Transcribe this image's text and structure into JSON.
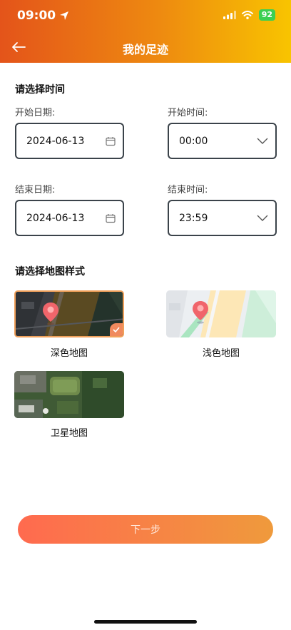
{
  "status": {
    "time": "09:00",
    "battery": "92"
  },
  "nav": {
    "title": "我的足迹"
  },
  "time_section": {
    "title": "请选择时间",
    "start_date_label": "开始日期:",
    "start_date_value": "2024-06-13",
    "start_time_label": "开始时间:",
    "start_time_value": "00:00",
    "end_date_label": "结束日期:",
    "end_date_value": "2024-06-13",
    "end_time_label": "结束时间:",
    "end_time_value": "23:59"
  },
  "map_section": {
    "title": "请选择地图样式",
    "styles": [
      {
        "label": "深色地图",
        "selected": true
      },
      {
        "label": "浅色地图",
        "selected": false
      },
      {
        "label": "卫星地图",
        "selected": false
      }
    ]
  },
  "next_button": {
    "label": "下一步"
  },
  "colors": {
    "accent_start": "#e4541a",
    "accent_end": "#f8c400",
    "check": "#f08a5d"
  }
}
